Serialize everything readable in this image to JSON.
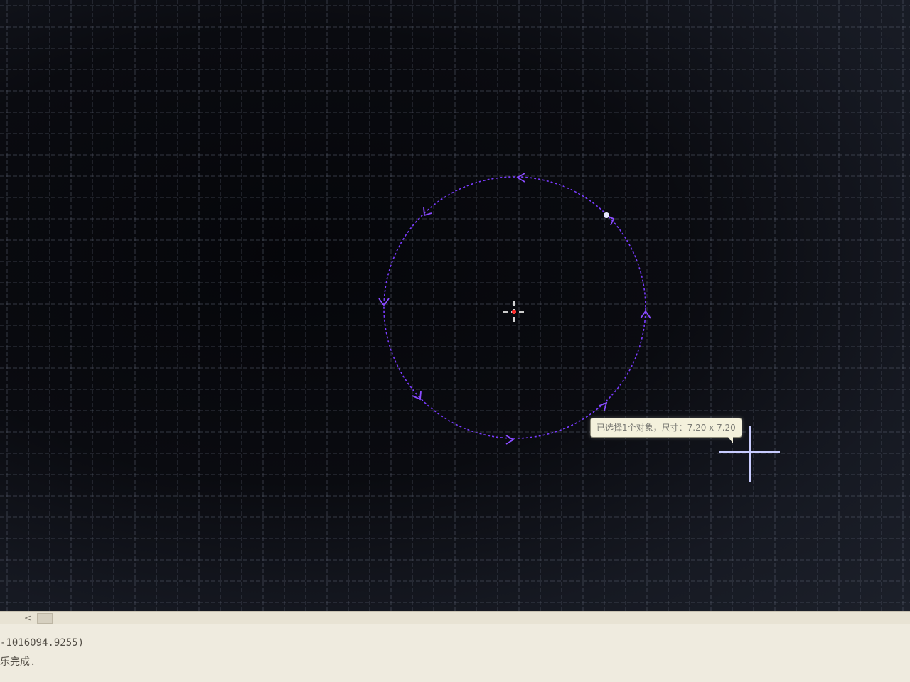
{
  "tooltip": {
    "text": "已选择1个对象，尺寸：7.20 x 7.20"
  },
  "command_history": {
    "line1": "-1016094.9255)",
    "line2": "乐完成."
  },
  "scrollbar": {
    "left_arrow": "<"
  },
  "colors": {
    "circle": "#7a3cff",
    "grid": "#5a6070",
    "center_marker": "#ff2a2a",
    "cursor": "#c8ccff"
  },
  "icons": {
    "center_mark": "crosshair-icon",
    "cursor": "cross-cursor-icon",
    "direction_arrows": "chevron-arrow-icon"
  }
}
